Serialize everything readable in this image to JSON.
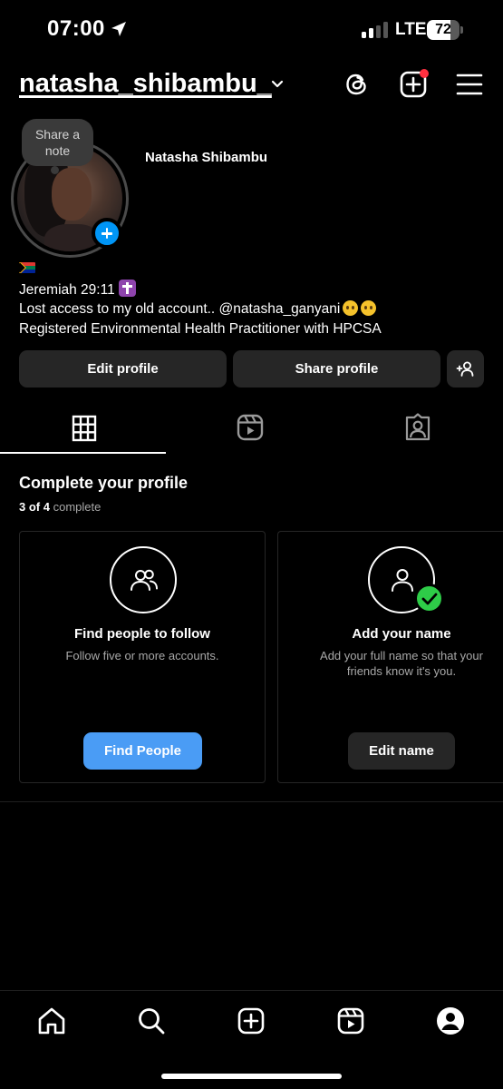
{
  "status_bar": {
    "time": "07:00",
    "network": "LTE",
    "battery_level": "72",
    "battery_fraction": 0.72
  },
  "header": {
    "username": "natasha_shibambu_",
    "icons": [
      "threads-icon",
      "new-post-icon",
      "menu-icon"
    ],
    "notification_dot_color": "#ff3040"
  },
  "profile": {
    "note_prompt": "Share a note",
    "display_name": "Natasha Shibambu",
    "bio": {
      "line1": "Jeremiah 29:11",
      "line2": "Lost access to my old account.. @natasha_ganyani",
      "line3": "Registered Environmental Health Practitioner with HPCSA"
    }
  },
  "actions": {
    "edit_profile": "Edit profile",
    "share_profile": "Share profile"
  },
  "tabs": [
    "grid-icon",
    "reels-icon",
    "tagged-icon"
  ],
  "complete_profile": {
    "title": "Complete your profile",
    "progress_count": "3 of 4",
    "progress_suffix": "complete",
    "cards": [
      {
        "title": "Find people to follow",
        "subtitle": "Follow five or more accounts.",
        "button": "Find People"
      },
      {
        "title": "Add your name",
        "subtitle": "Add your full name so that your friends know it's you.",
        "button": "Edit name"
      }
    ]
  },
  "bottom_nav": [
    "home-icon",
    "search-icon",
    "create-icon",
    "reels-icon",
    "profile-icon"
  ],
  "colors": {
    "accent": "#4a9cf5",
    "button_bg": "#262626",
    "success": "#2ecc48",
    "background": "#000000"
  }
}
